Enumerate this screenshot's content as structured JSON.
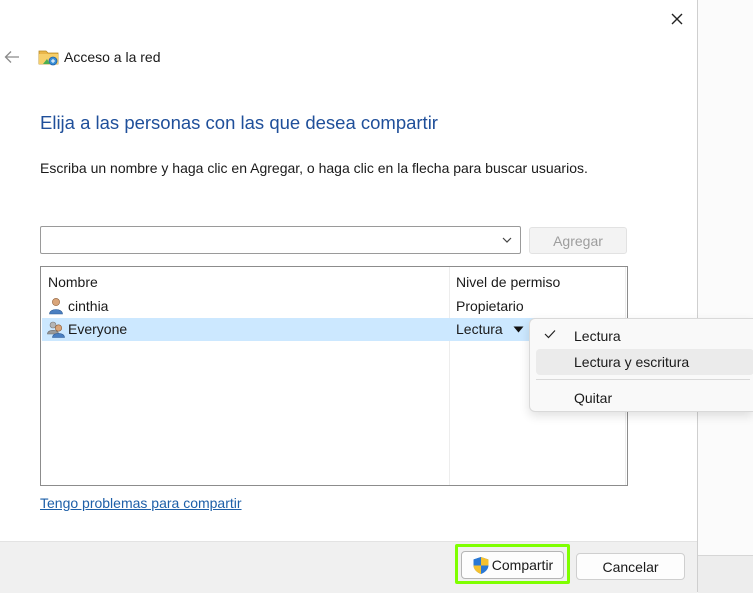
{
  "window": {
    "title": "Acceso a la red",
    "close_icon": "close-icon",
    "back_icon": "arrow-left-icon"
  },
  "main": {
    "heading": "Elija a las personas con las que desea compartir",
    "instruction": "Escriba un nombre y haga clic en Agregar, o haga clic en la flecha para buscar usuarios.",
    "name_input": {
      "value": "",
      "placeholder": ""
    },
    "add_button": "Agregar",
    "add_button_enabled": false
  },
  "table": {
    "columns": [
      "Nombre",
      "Nivel de permiso"
    ],
    "rows": [
      {
        "name": "cinthia",
        "permission": "Propietario",
        "icon": "user-icon",
        "selected": false
      },
      {
        "name": "Everyone",
        "permission": "Lectura",
        "icon": "users-group-icon",
        "selected": true
      }
    ]
  },
  "help_link": "Tengo problemas para compartir",
  "footer": {
    "share_button": "Compartir",
    "cancel_button": "Cancelar",
    "share_icon": "uac-shield-icon"
  },
  "permission_menu": {
    "items": [
      {
        "label": "Lectura",
        "checked": true
      },
      {
        "label": "Lectura y escritura",
        "checked": false,
        "hovered": true
      },
      {
        "label": "Quitar",
        "checked": false
      }
    ]
  },
  "colors": {
    "heading": "#1f4f9a",
    "link": "#1d5fa8",
    "selection": "#cce8ff",
    "highlight": "#7fff00"
  }
}
